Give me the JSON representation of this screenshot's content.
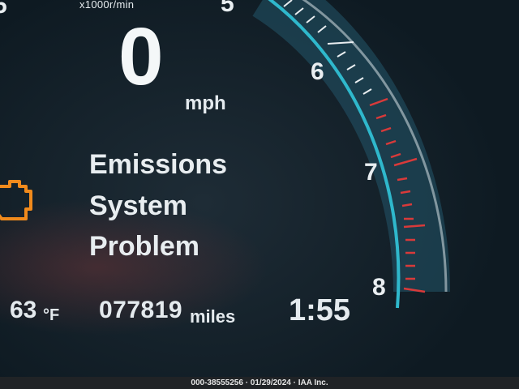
{
  "gauge": {
    "unit_label": "x1000r/min",
    "numbers": [
      "5",
      "6",
      "7",
      "8"
    ],
    "edge_number": "5",
    "redline_color": "#d83a3a",
    "arc_color": "#2fb8cc"
  },
  "speedometer": {
    "value": "0",
    "unit": "mph"
  },
  "warning": {
    "icon": "check-engine-icon",
    "color": "#f08a1c",
    "lines": [
      "Emissions",
      "System",
      "Problem"
    ]
  },
  "status_bar": {
    "temperature": "63",
    "temperature_unit": "°F",
    "odometer": "077819",
    "odometer_unit": "miles",
    "clock": "1:55"
  },
  "watermark": "000-38555256 · 01/29/2024 · IAA Inc."
}
